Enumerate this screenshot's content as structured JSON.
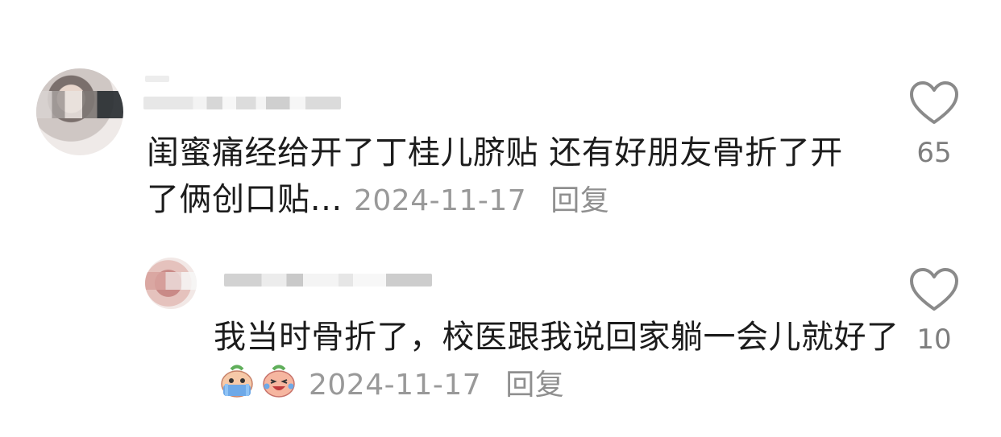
{
  "comments": [
    {
      "text": "闺蜜痛经给开了丁桂儿脐贴 还有好朋友骨折了开了俩创口贴…",
      "date": "2024-11-17",
      "reply_label": "回复",
      "likes": "65",
      "like_icon": "heart-outline-icon"
    },
    {
      "text": "我当时骨折了，校医跟我说回家躺一会儿就好了",
      "date": "2024-11-17",
      "reply_label": "回复",
      "likes": "10",
      "like_icon": "heart-outline-icon",
      "emojis": [
        "crying-emoji",
        "laughing-crying-emoji"
      ]
    }
  ],
  "colors": {
    "text": "#1c1c1c",
    "meta": "#999999",
    "heart": "#8a8a8a"
  }
}
